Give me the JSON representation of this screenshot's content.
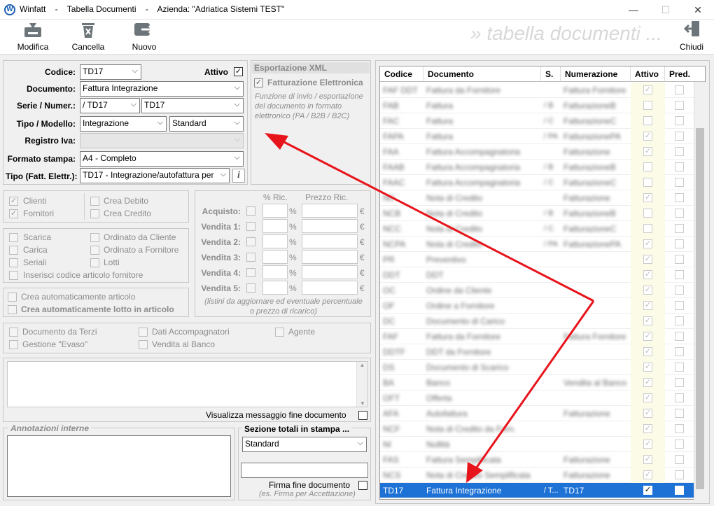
{
  "window": {
    "app": "Winfatt",
    "title_text": "Winfatt    -    Tabella Documenti    -    Azienda: \"Adriatica Sistemi TEST\"",
    "min": "—",
    "max": "☐",
    "close": "✕"
  },
  "toolbar": {
    "modifica": "Modifica",
    "cancella": "Cancella",
    "nuovo": "Nuovo",
    "chiudi": "Chiudi",
    "watermark": "» tabella documenti ..."
  },
  "form": {
    "codice_label": "Codice:",
    "codice_value": "TD17",
    "attivo_label": "Attivo",
    "documento_label": "Documento:",
    "documento_value": "Fattura Integrazione",
    "serie_label": "Serie / Numer.:",
    "serie_value": "/ TD17",
    "numer_value": "TD17",
    "tipo_label": "Tipo / Modello:",
    "tipo_value": "Integrazione",
    "modello_value": "Standard",
    "registro_label": "Registro Iva:",
    "registro_value": "",
    "formato_label": "Formato stampa:",
    "formato_value": "A4 - Completo",
    "tipofe_label": "Tipo (Fatt. Elettr.):",
    "tipofe_value": "TD17 - Integrazione/autofattura per"
  },
  "xml": {
    "header": "Esportazione XML",
    "fe_label": "Fatturazione Elettronica",
    "note": "Funzione di invio / esportazione\ndel documento in formato\nelettronico (PA / B2B / B2C)"
  },
  "options": {
    "clienti": "Clienti",
    "fornitori": "Fornitori",
    "crea_debito": "Crea Debito",
    "crea_credito": "Crea Credito",
    "scarica": "Scarica",
    "carica": "Carica",
    "seriali": "Seriali",
    "ordinato_cliente": "Ordinato da Cliente",
    "ordinato_fornitore": "Ordinato a Fornitore",
    "lotti": "Lotti",
    "inserisci_codice": "Inserisci codice articolo fornitore",
    "crea_articolo": "Crea automaticamente articolo",
    "crea_lotto": "Crea automaticamente lotto in articolo",
    "doc_terzi": "Documento da Terzi",
    "dati_accomp": "Dati Accompagnatori",
    "agente": "Agente",
    "gestione_evaso": "Gestione \"Evaso\"",
    "vendita_banco": "Vendita al Banco"
  },
  "pricing": {
    "pct_header": "% Ric.",
    "prezzo_header": "Prezzo Ric.",
    "rows": [
      "Acquisto:",
      "Vendita 1:",
      "Vendita 2:",
      "Vendita 3:",
      "Vendita 4:",
      "Vendita 5:"
    ],
    "pct_sign": "%",
    "euro_sign": "€",
    "note": "(listini da aggiornare ed eventuale percentuale\no prezzo di ricarico)"
  },
  "messages": {
    "visualizza": "Visualizza messaggio fine documento",
    "annotazioni": "Annotazioni interne",
    "sezione_label": "Sezione totali in stampa ...",
    "sezione_value": "Standard",
    "firma_label": "Firma fine documento",
    "firma_note": "(es. Firma per Accettazione)"
  },
  "table": {
    "headers": [
      "Codice",
      "Documento",
      "S.",
      "Numerazione",
      "Attivo",
      "Pred."
    ],
    "rows": [
      {
        "codice": "FAF DDT",
        "documento": "Fattura da Fornitore",
        "serie": "",
        "num": "Fattura Fornitore",
        "attivo": true,
        "pred": false
      },
      {
        "codice": "FAB",
        "documento": "Fattura",
        "serie": "/ B",
        "num": "FatturazioneB",
        "attivo": false,
        "pred": false
      },
      {
        "codice": "FAC",
        "documento": "Fattura",
        "serie": "/ C",
        "num": "FatturazioneC",
        "attivo": false,
        "pred": false
      },
      {
        "codice": "FAPA",
        "documento": "Fattura",
        "serie": "/ PA",
        "num": "FatturazionePA",
        "attivo": true,
        "pred": false
      },
      {
        "codice": "FAA",
        "documento": "Fattura Accompagnatoria",
        "serie": "",
        "num": "Fatturazione",
        "attivo": true,
        "pred": false
      },
      {
        "codice": "FAAB",
        "documento": "Fattura Accompagnatoria",
        "serie": "/ B",
        "num": "FatturazioneB",
        "attivo": false,
        "pred": false
      },
      {
        "codice": "FAAC",
        "documento": "Fattura Accompagnatoria",
        "serie": "/ C",
        "num": "FatturazioneC",
        "attivo": false,
        "pred": false
      },
      {
        "codice": "NC",
        "documento": "Nota di Credito",
        "serie": "",
        "num": "Fatturazione",
        "attivo": true,
        "pred": false
      },
      {
        "codice": "NCB",
        "documento": "Nota di Credito",
        "serie": "/ B",
        "num": "FatturazioneB",
        "attivo": false,
        "pred": false
      },
      {
        "codice": "NCC",
        "documento": "Nota di Credito",
        "serie": "/ C",
        "num": "FatturazioneC",
        "attivo": false,
        "pred": false
      },
      {
        "codice": "NCPA",
        "documento": "Nota di Credito",
        "serie": "/ PA",
        "num": "FatturazionePA",
        "attivo": true,
        "pred": false
      },
      {
        "codice": "PR",
        "documento": "Preventivo",
        "serie": "",
        "num": "",
        "attivo": true,
        "pred": false
      },
      {
        "codice": "DDT",
        "documento": "DDT",
        "serie": "",
        "num": "",
        "attivo": true,
        "pred": false
      },
      {
        "codice": "OC",
        "documento": "Ordine da Cliente",
        "serie": "",
        "num": "",
        "attivo": true,
        "pred": false
      },
      {
        "codice": "OF",
        "documento": "Ordine a Fornitore",
        "serie": "",
        "num": "",
        "attivo": true,
        "pred": false
      },
      {
        "codice": "DC",
        "documento": "Documento di Carico",
        "serie": "",
        "num": "",
        "attivo": true,
        "pred": false
      },
      {
        "codice": "FAF",
        "documento": "Fattura da Fornitore",
        "serie": "",
        "num": "Fattura Fornitore",
        "attivo": true,
        "pred": false
      },
      {
        "codice": "DDTF",
        "documento": "DDT da Fornitore",
        "serie": "",
        "num": "",
        "attivo": true,
        "pred": false
      },
      {
        "codice": "DS",
        "documento": "Documento di Scarico",
        "serie": "",
        "num": "",
        "attivo": true,
        "pred": false
      },
      {
        "codice": "BA",
        "documento": "Banco",
        "serie": "",
        "num": "Vendita al Banco",
        "attivo": true,
        "pred": false
      },
      {
        "codice": "OFT",
        "documento": "Offerta",
        "serie": "",
        "num": "",
        "attivo": true,
        "pred": false
      },
      {
        "codice": "AFA",
        "documento": "Autofattura",
        "serie": "",
        "num": "Fatturazione",
        "attivo": true,
        "pred": false
      },
      {
        "codice": "NCF",
        "documento": "Nota di Credito da Forn.",
        "serie": "",
        "num": "",
        "attivo": true,
        "pred": false
      },
      {
        "codice": "NI",
        "documento": "Nullità",
        "serie": "",
        "num": "",
        "attivo": true,
        "pred": false
      },
      {
        "codice": "FAS",
        "documento": "Fattura Semplificata",
        "serie": "",
        "num": "Fatturazione",
        "attivo": true,
        "pred": false
      },
      {
        "codice": "NCS",
        "documento": "Nota di Credito Semplificata",
        "serie": "",
        "num": "Fatturazione",
        "attivo": true,
        "pred": false
      }
    ],
    "selected": {
      "codice": "TD17",
      "documento": "Fattura Integrazione",
      "serie": "/ T...",
      "num": "TD17",
      "attivo": true,
      "pred": false
    }
  },
  "colors": {
    "accent": "#1e72d6",
    "arrow": "#e8141b"
  }
}
